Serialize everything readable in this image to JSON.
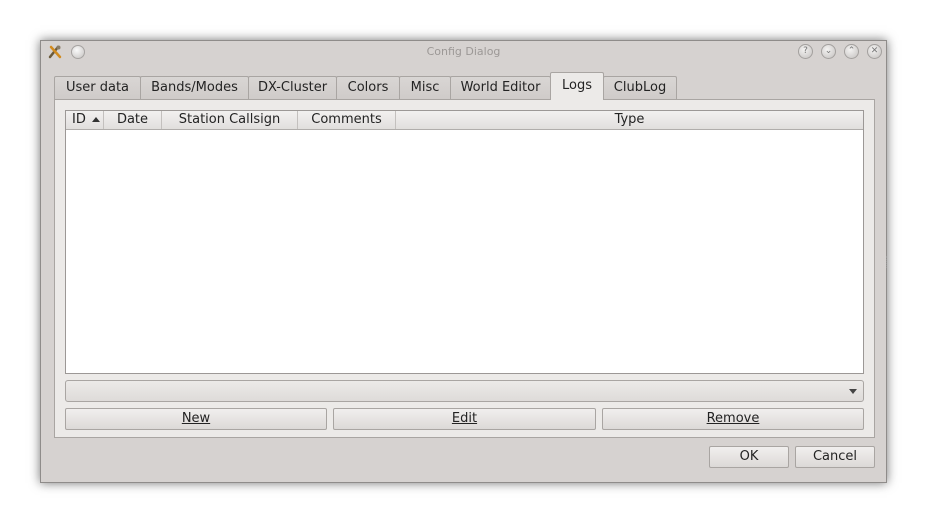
{
  "window": {
    "title": "Config Dialog",
    "help_icon": "?",
    "minimize_icon": "⌄",
    "maximize_icon": "⌃",
    "close_icon": "✕"
  },
  "tabs": [
    {
      "label": "User data"
    },
    {
      "label": "Bands/Modes"
    },
    {
      "label": "DX-Cluster"
    },
    {
      "label": "Colors"
    },
    {
      "label": "Misc"
    },
    {
      "label": "World Editor"
    },
    {
      "label": "Logs",
      "active": true
    },
    {
      "label": "ClubLog"
    }
  ],
  "table": {
    "columns": [
      "ID",
      "Date",
      "Station Callsign",
      "Comments",
      "Type"
    ],
    "sort_column": "ID",
    "sort_order": "ascending",
    "rows": []
  },
  "log_selector": {
    "value": ""
  },
  "buttons": {
    "new_label": "New",
    "edit_label": "Edit",
    "remove_label": "Remove",
    "ok_label": "OK",
    "cancel_label": "Cancel"
  }
}
